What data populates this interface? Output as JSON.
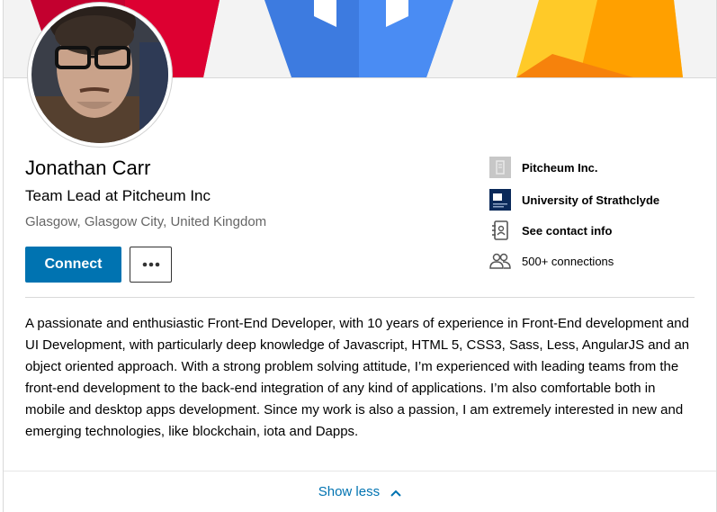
{
  "profile": {
    "name": "Jonathan Carr",
    "headline": "Team Lead at Pitcheum Inc",
    "location": "Glasgow, Glasgow City, United Kingdom"
  },
  "actions": {
    "connect_label": "Connect",
    "more_icon": "more-horizontal-icon"
  },
  "sidebar": {
    "company": "Pitcheum Inc.",
    "school": "University of Strathclyde",
    "contact": "See contact info",
    "connections": "500+ connections"
  },
  "summary": "A passionate and enthusiastic Front-End Developer, with 10 years of experience in Front-End development and UI Development, with particularly deep knowledge of Javascript, HTML 5, CSS3, Sass, Less, AngularJS and an object oriented approach. With a strong problem solving attitude, I’m experienced with leading teams from the front-end development to the back-end integration of any kind of applications. I’m also comfortable both in mobile and desktop apps development. Since my work is also a passion, I am extremely interested in new and emerging technologies, like blockchain, iota and Dapps.",
  "footer": {
    "show_less": "Show less"
  },
  "colors": {
    "accent": "#0073b1",
    "banner_red": "#c3002f",
    "banner_blue": "#4285f4",
    "banner_yellow": "#ffca28"
  }
}
